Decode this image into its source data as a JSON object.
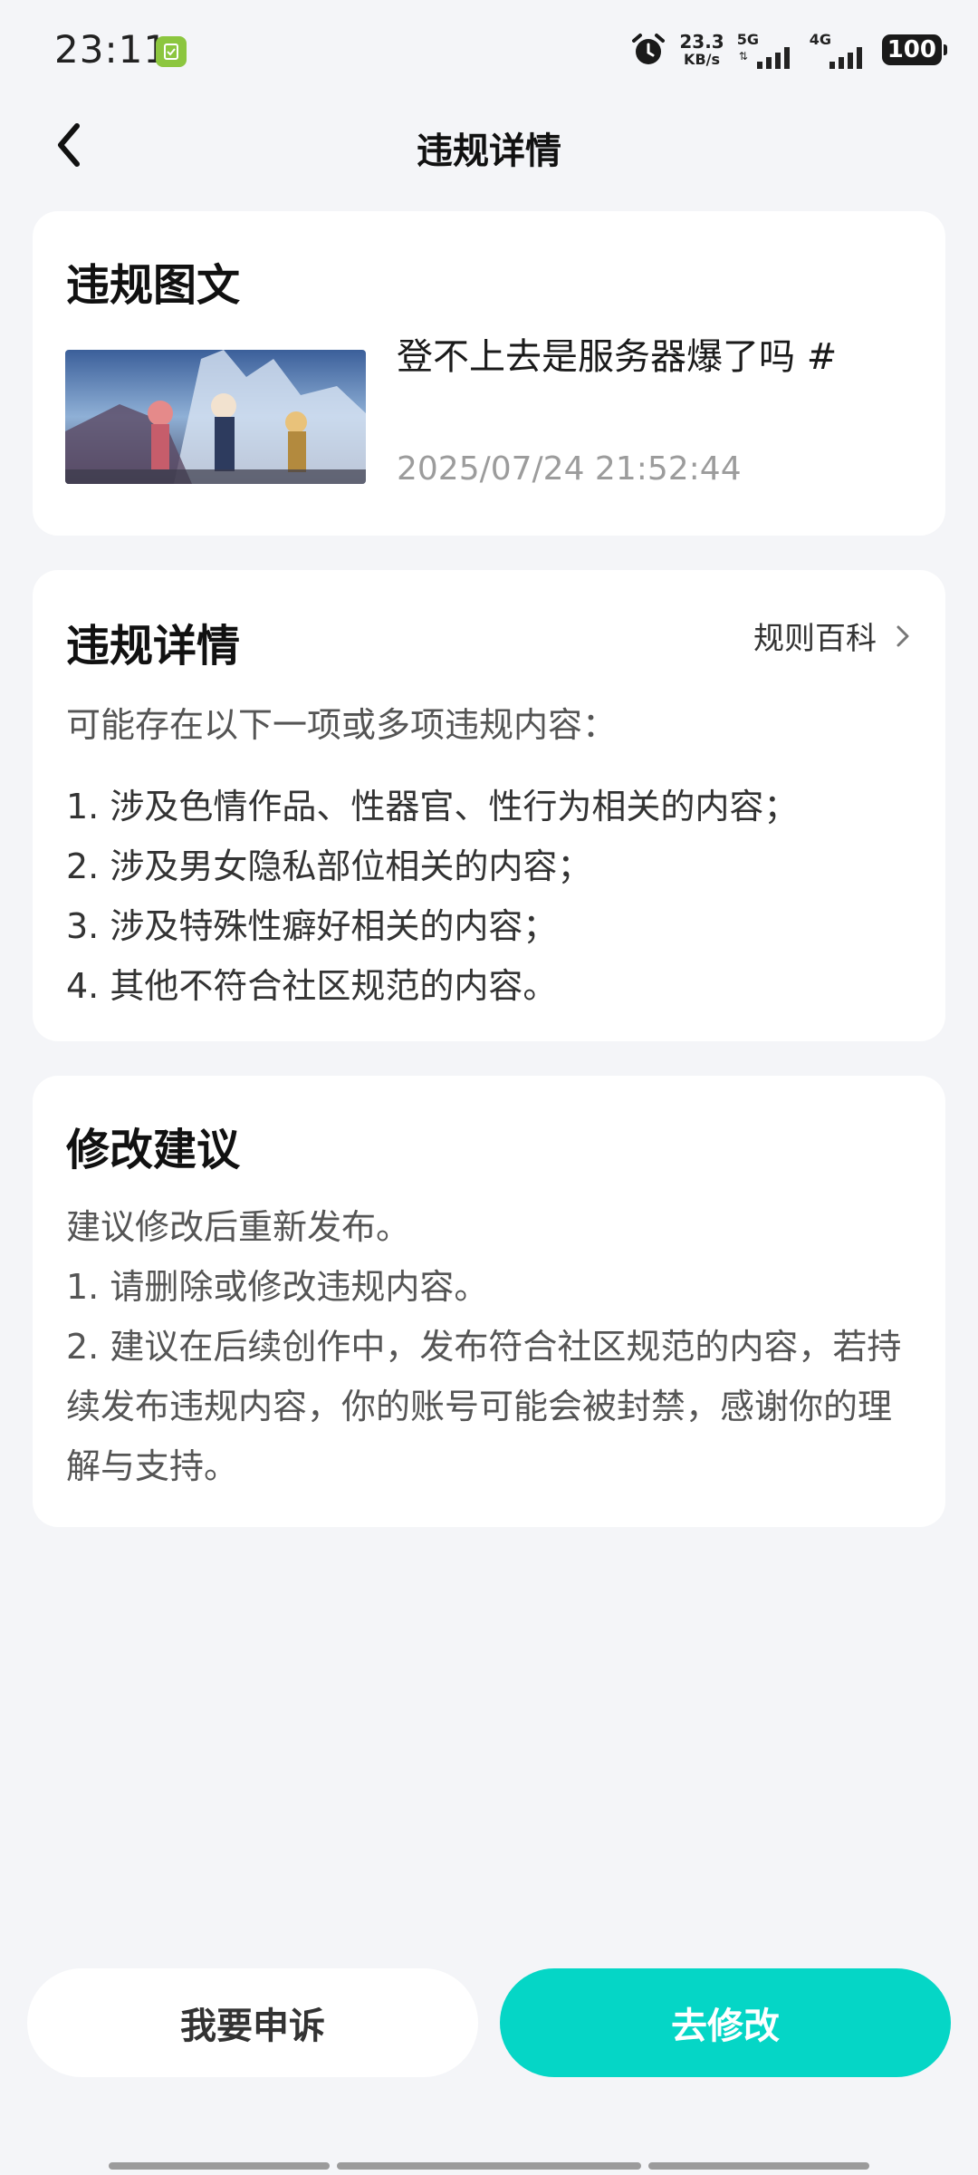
{
  "status_bar": {
    "time": "23:11",
    "net_speed_value": "23.3",
    "net_speed_unit": "KB/s",
    "signal_1_label": "5G",
    "signal_2_label": "4G",
    "battery": "100",
    "app_badge_color": "#8cc63f"
  },
  "header": {
    "title": "违规详情",
    "back_icon": "chevron-left-icon"
  },
  "post_card": {
    "title": "违规图文",
    "post_text": "登不上去是服务器爆了吗 #",
    "timestamp": "2025/07/24 21:52:44",
    "thumbnail_icon": "anime-game-artwork"
  },
  "detail_card": {
    "title": "违规详情",
    "rules_link": "规则百科",
    "intro": "可能存在以下一项或多项违规内容：",
    "items": [
      "1. 涉及色情作品、性器官、性行为相关的内容；",
      "2. 涉及男女隐私部位相关的内容；",
      "3. 涉及特殊性癖好相关的内容；",
      "4. 其他不符合社区规范的内容。"
    ]
  },
  "suggest_card": {
    "title": "修改建议",
    "lines": [
      "建议修改后重新发布。",
      "1. 请删除或修改违规内容。",
      "2. 建议在后续创作中，发布符合社区规范的内容，若持续发布违规内容，你的账号可能会被封禁，感谢你的理解与支持。"
    ]
  },
  "actions": {
    "appeal_label": "我要申诉",
    "modify_label": "去修改",
    "accent_color": "#05d6c6"
  }
}
